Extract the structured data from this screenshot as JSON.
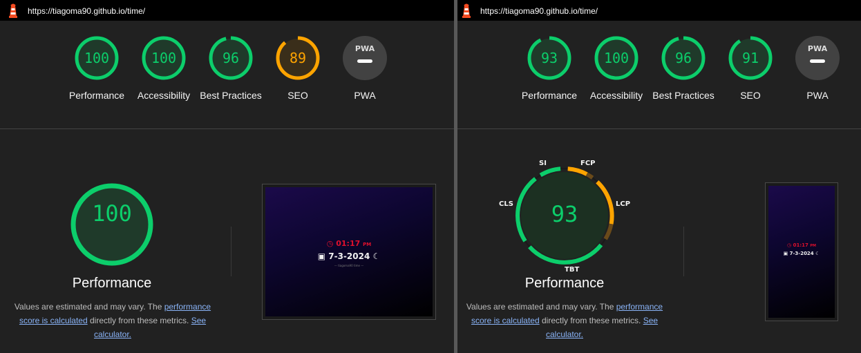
{
  "left": {
    "url": "https://tiagoma90.github.io/time/",
    "categories": [
      {
        "score": "100",
        "label": "Performance",
        "value": 100,
        "color": "#0cce6b"
      },
      {
        "score": "100",
        "label": "Accessibility",
        "value": 100,
        "color": "#0cce6b"
      },
      {
        "score": "96",
        "label": "Best Practices",
        "value": 96,
        "color": "#0cce6b"
      },
      {
        "score": "89",
        "label": "SEO",
        "value": 89,
        "color": "#ffa400"
      },
      {
        "score": "",
        "label": "PWA",
        "value": 0,
        "color": "#ffffff"
      }
    ],
    "perf_score": "100",
    "perf_title": "Performance",
    "desc_pre": "Values are estimated and may vary. The ",
    "desc_link1": "performance score is calculated",
    "desc_mid": " directly from these metrics. ",
    "desc_link2": "See calculator.",
    "screenshot": {
      "time": "01:17",
      "ampm": "PM",
      "date": "7-3-2024",
      "footer": "— tiagoma90 time —"
    }
  },
  "right": {
    "url": "https://tiagoma90.github.io/time/",
    "categories": [
      {
        "score": "93",
        "label": "Performance",
        "value": 93,
        "color": "#0cce6b"
      },
      {
        "score": "100",
        "label": "Accessibility",
        "value": 100,
        "color": "#0cce6b"
      },
      {
        "score": "96",
        "label": "Best Practices",
        "value": 96,
        "color": "#0cce6b"
      },
      {
        "score": "91",
        "label": "SEO",
        "value": 91,
        "color": "#0cce6b"
      },
      {
        "score": "",
        "label": "PWA",
        "value": 0,
        "color": "#ffffff"
      }
    ],
    "perf_score": "93",
    "perf_title": "Performance",
    "metrics": {
      "si": "SI",
      "fcp": "FCP",
      "lcp": "LCP",
      "tbt": "TBT",
      "cls": "CLS"
    },
    "desc_pre": "Values are estimated and may vary. The ",
    "desc_link1": "performance score is calculated",
    "desc_mid": " directly from these metrics. ",
    "desc_link2": "See calculator.",
    "screenshot": {
      "time": "01:17",
      "ampm": "PM",
      "date": "7-3-2024"
    }
  },
  "pwa_badge": "PWA",
  "colors": {
    "pass": "#0cce6b",
    "average": "#ffa400",
    "panel": "#212121",
    "topbar": "#000000"
  }
}
